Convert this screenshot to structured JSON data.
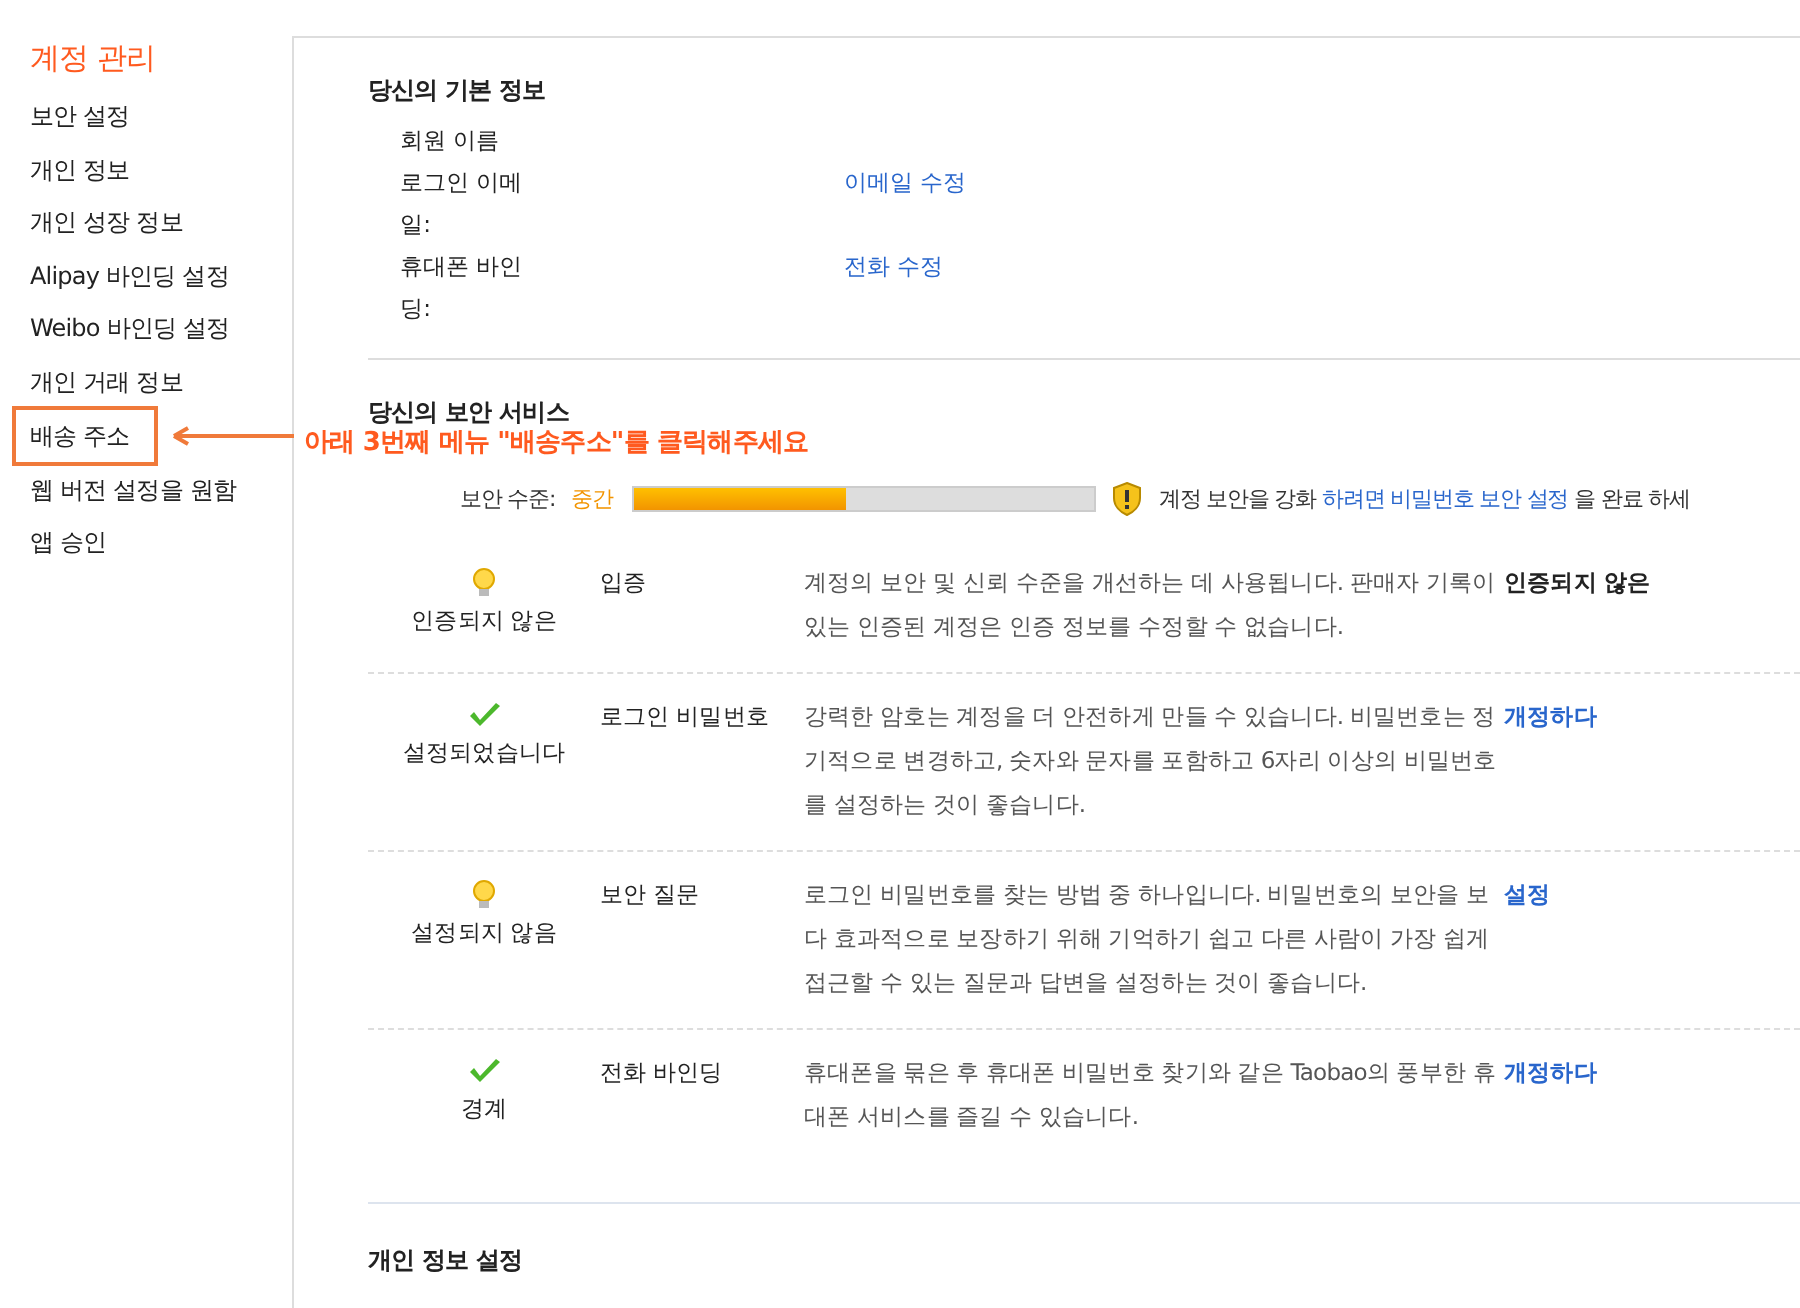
{
  "sidebar": {
    "title": "계정 관리",
    "items": [
      {
        "label": "보안 설정",
        "selected": false
      },
      {
        "label": "개인 정보",
        "selected": false
      },
      {
        "label": "개인 성장 정보",
        "selected": false
      },
      {
        "label": "Alipay 바인딩 설정",
        "selected": false
      },
      {
        "label": "Weibo 바인딩 설정",
        "selected": false
      },
      {
        "label": "개인 거래 정보",
        "selected": false
      },
      {
        "label": "배송 주소",
        "selected": true
      },
      {
        "label": "웹 버전 설정을 원함",
        "selected": false
      },
      {
        "label": "앱 승인",
        "selected": false
      }
    ]
  },
  "annotation": {
    "text": "아래 3번째 메뉴 \"배송주소\"를 클릭해주세요"
  },
  "basic_info": {
    "title": "당신의 기본 정보",
    "rows": [
      {
        "label": "회원 이름"
      },
      {
        "label": "로그인 이메일:",
        "link": "이메일 수정"
      },
      {
        "label": "휴대폰 바인딩:",
        "link": "전화 수정"
      }
    ]
  },
  "security": {
    "title": "당신의 보안 서비스",
    "level_label": "보안 수준:",
    "level_text": "중간",
    "level": 0.46,
    "advice": {
      "before": "계정 보안을 강화",
      "link1": "하려면 비밀번호 보안 설정",
      "after": "을 완료 하세"
    },
    "items": [
      {
        "kind": "bulb",
        "status": "인증되지 않은",
        "title": "입증",
        "description": "계정의 보안 및 신뢰 수준을 개선하는 데 사용됩니다. 판매자 기록이 있는 인증된 계정은 인증 정보를 수정할 수 없습니다.",
        "action": "인증되지 않은",
        "action_is_link": false
      },
      {
        "kind": "check",
        "status": "설정되었습니다",
        "title": "로그인 비밀번호",
        "description": "강력한 암호는 계정을 더 안전하게 만들 수 있습니다. 비밀번호는 정기적으로 변경하고, 숫자와 문자를 포함하고 6자리 이상의 비밀번호를 설정하는 것이 좋습니다.",
        "action": "개정하다",
        "action_is_link": true
      },
      {
        "kind": "bulb",
        "status": "설정되지 않음",
        "title": "보안 질문",
        "description": "로그인 비밀번호를 찾는 방법 중 하나입니다. 비밀번호의 보안을 보다 효과적으로 보장하기 위해 기억하기 쉽고 다른 사람이 가장 쉽게 접근할 수 있는 질문과 답변을 설정하는 것이 좋습니다.",
        "action": "설정",
        "action_is_link": true
      },
      {
        "kind": "check",
        "status": "경계",
        "title": "전화 바인딩",
        "description": "휴대폰을 묶은 후 휴대폰 비밀번호 찾기와 같은 Taobao의 풍부한 휴대폰 서비스를 즐길 수 있습니다.",
        "action": "개정하다",
        "action_is_link": true
      }
    ]
  },
  "personal": {
    "title": "개인 정보 설정"
  }
}
